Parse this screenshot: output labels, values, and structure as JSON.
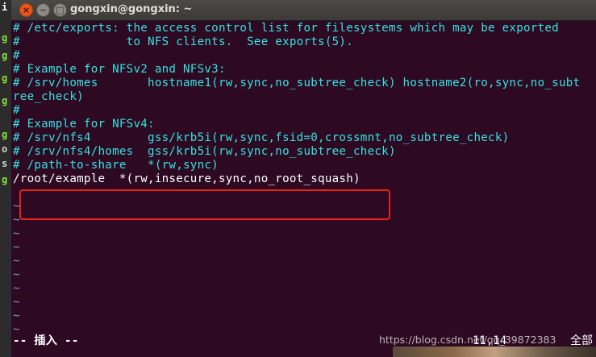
{
  "window": {
    "title": "gongxin@gongxin: ~",
    "close_glyph": "×",
    "min_glyph": "−",
    "max_glyph": "□"
  },
  "desktop_left_chars": [
    "i",
    "g",
    "g",
    "g",
    "g",
    "g",
    "o",
    "s",
    "g"
  ],
  "editor_lines": [
    {
      "text": "# /etc/exports: the access control list for filesystems which may be exported",
      "kind": "comment"
    },
    {
      "text": "#               to NFS clients.  See exports(5).",
      "kind": "comment"
    },
    {
      "text": "#",
      "kind": "comment"
    },
    {
      "text": "# Example for NFSv2 and NFSv3:",
      "kind": "comment"
    },
    {
      "text": "# /srv/homes       hostname1(rw,sync,no_subtree_check) hostname2(ro,sync,no_subt",
      "kind": "comment"
    },
    {
      "text": "ree_check)",
      "kind": "comment"
    },
    {
      "text": "#",
      "kind": "comment"
    },
    {
      "text": "# Example for NFSv4:",
      "kind": "comment"
    },
    {
      "text": "# /srv/nfs4        gss/krb5i(rw,sync,fsid=0,crossmnt,no_subtree_check)",
      "kind": "comment"
    },
    {
      "text": "# /srv/nfs4/homes  gss/krb5i(rw,sync,no_subtree_check)",
      "kind": "comment"
    },
    {
      "text": "# /path-to-share   *(rw,sync)",
      "kind": "comment"
    },
    {
      "text": "/root/example  *(rw,insecure,sync,no_root_squash)",
      "kind": "normal"
    },
    {
      "text": "",
      "kind": "normal"
    },
    {
      "text": "~",
      "kind": "tilde"
    },
    {
      "text": "~",
      "kind": "tilde"
    },
    {
      "text": "~",
      "kind": "tilde"
    },
    {
      "text": "~",
      "kind": "tilde"
    },
    {
      "text": "~",
      "kind": "tilde"
    },
    {
      "text": "~",
      "kind": "tilde"
    },
    {
      "text": "~",
      "kind": "tilde"
    },
    {
      "text": "~",
      "kind": "tilde"
    },
    {
      "text": "~",
      "kind": "tilde"
    },
    {
      "text": "~",
      "kind": "tilde"
    }
  ],
  "status_bar": {
    "mode": "-- 插入 --",
    "cursor_position": "11,14",
    "scroll_position": "全部"
  },
  "watermark": "https://blog.csdn.net/qq_39872383"
}
